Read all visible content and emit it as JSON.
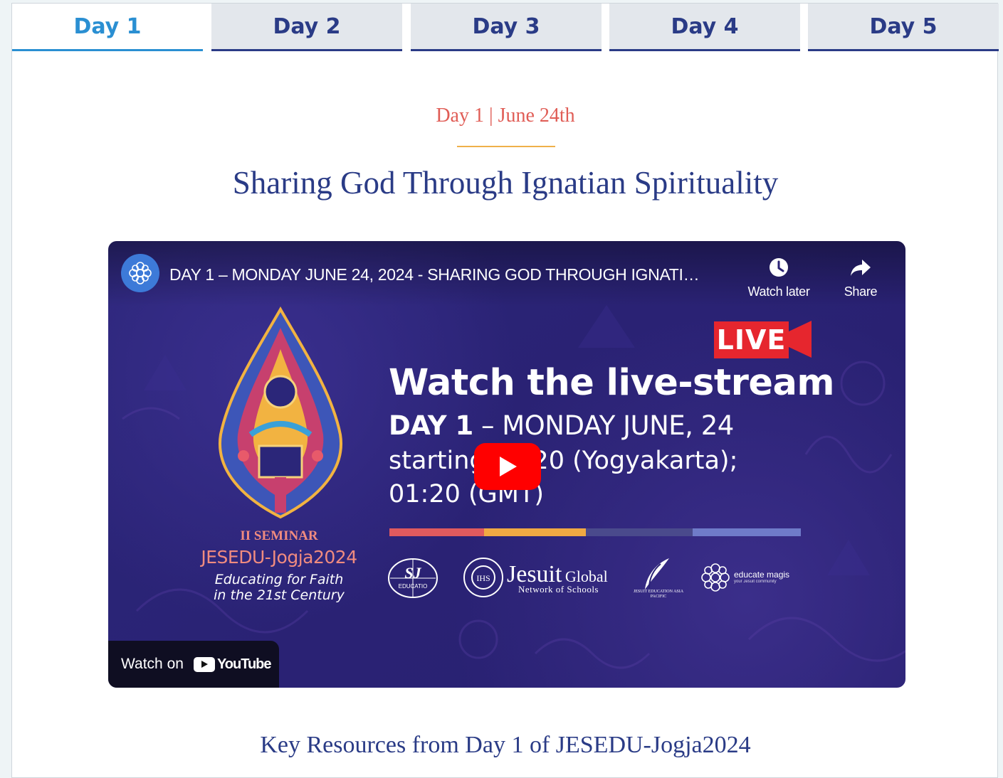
{
  "tabs": [
    {
      "label": "Day 1",
      "active": true
    },
    {
      "label": "Day 2",
      "active": false
    },
    {
      "label": "Day 3",
      "active": false
    },
    {
      "label": "Day 4",
      "active": false
    },
    {
      "label": "Day 5",
      "active": false
    }
  ],
  "content": {
    "date_line": "Day 1 | June 24th",
    "title": "Sharing God Through Ignatian Spirituality",
    "resources_title": "Key Resources from Day 1 of JESEDU-Jogja2024"
  },
  "video": {
    "title": "DAY 1 – MONDAY JUNE 24, 2024 - SHARING GOD THROUGH IGNATI…",
    "watch_later_label": "Watch later",
    "share_label": "Share",
    "watch_on_label": "Watch on",
    "youtube_wordmark": "YouTube",
    "thumbnail": {
      "live_badge": "LIVE",
      "headline": "Watch the live-stream",
      "day_bold": "DAY 1",
      "day_rest": " – MONDAY JUNE, 24",
      "start_line_1": "starting 08.20 (Yogyakarta);",
      "start_line_2": "01:20 (GMT)",
      "seminar_top": "II SEMINAR",
      "seminar_name": "JESEDU-Jogja2024",
      "seminar_tag_1": "Educating for Faith",
      "seminar_tag_2": "in the 21st Century",
      "partner_jesuit_big": "Jesuit",
      "partner_jesuit_global": "Global",
      "partner_jesuit_sub": "Network of Schools",
      "partner_jean_caption": "JESUIT EDUCATION ASIA PACIFIC",
      "partner_educate": "educate magis",
      "partner_educate_sub": "your Jesuit community",
      "partner_sj": "SJ",
      "partner_sj_sub": "EDUCATIO"
    }
  },
  "colors": {
    "navy": "#2a3b86",
    "active_tab": "#2a8fd2",
    "date_red": "#e05d56",
    "divider_gold": "#efb04a",
    "youtube_red": "#ff0000"
  }
}
